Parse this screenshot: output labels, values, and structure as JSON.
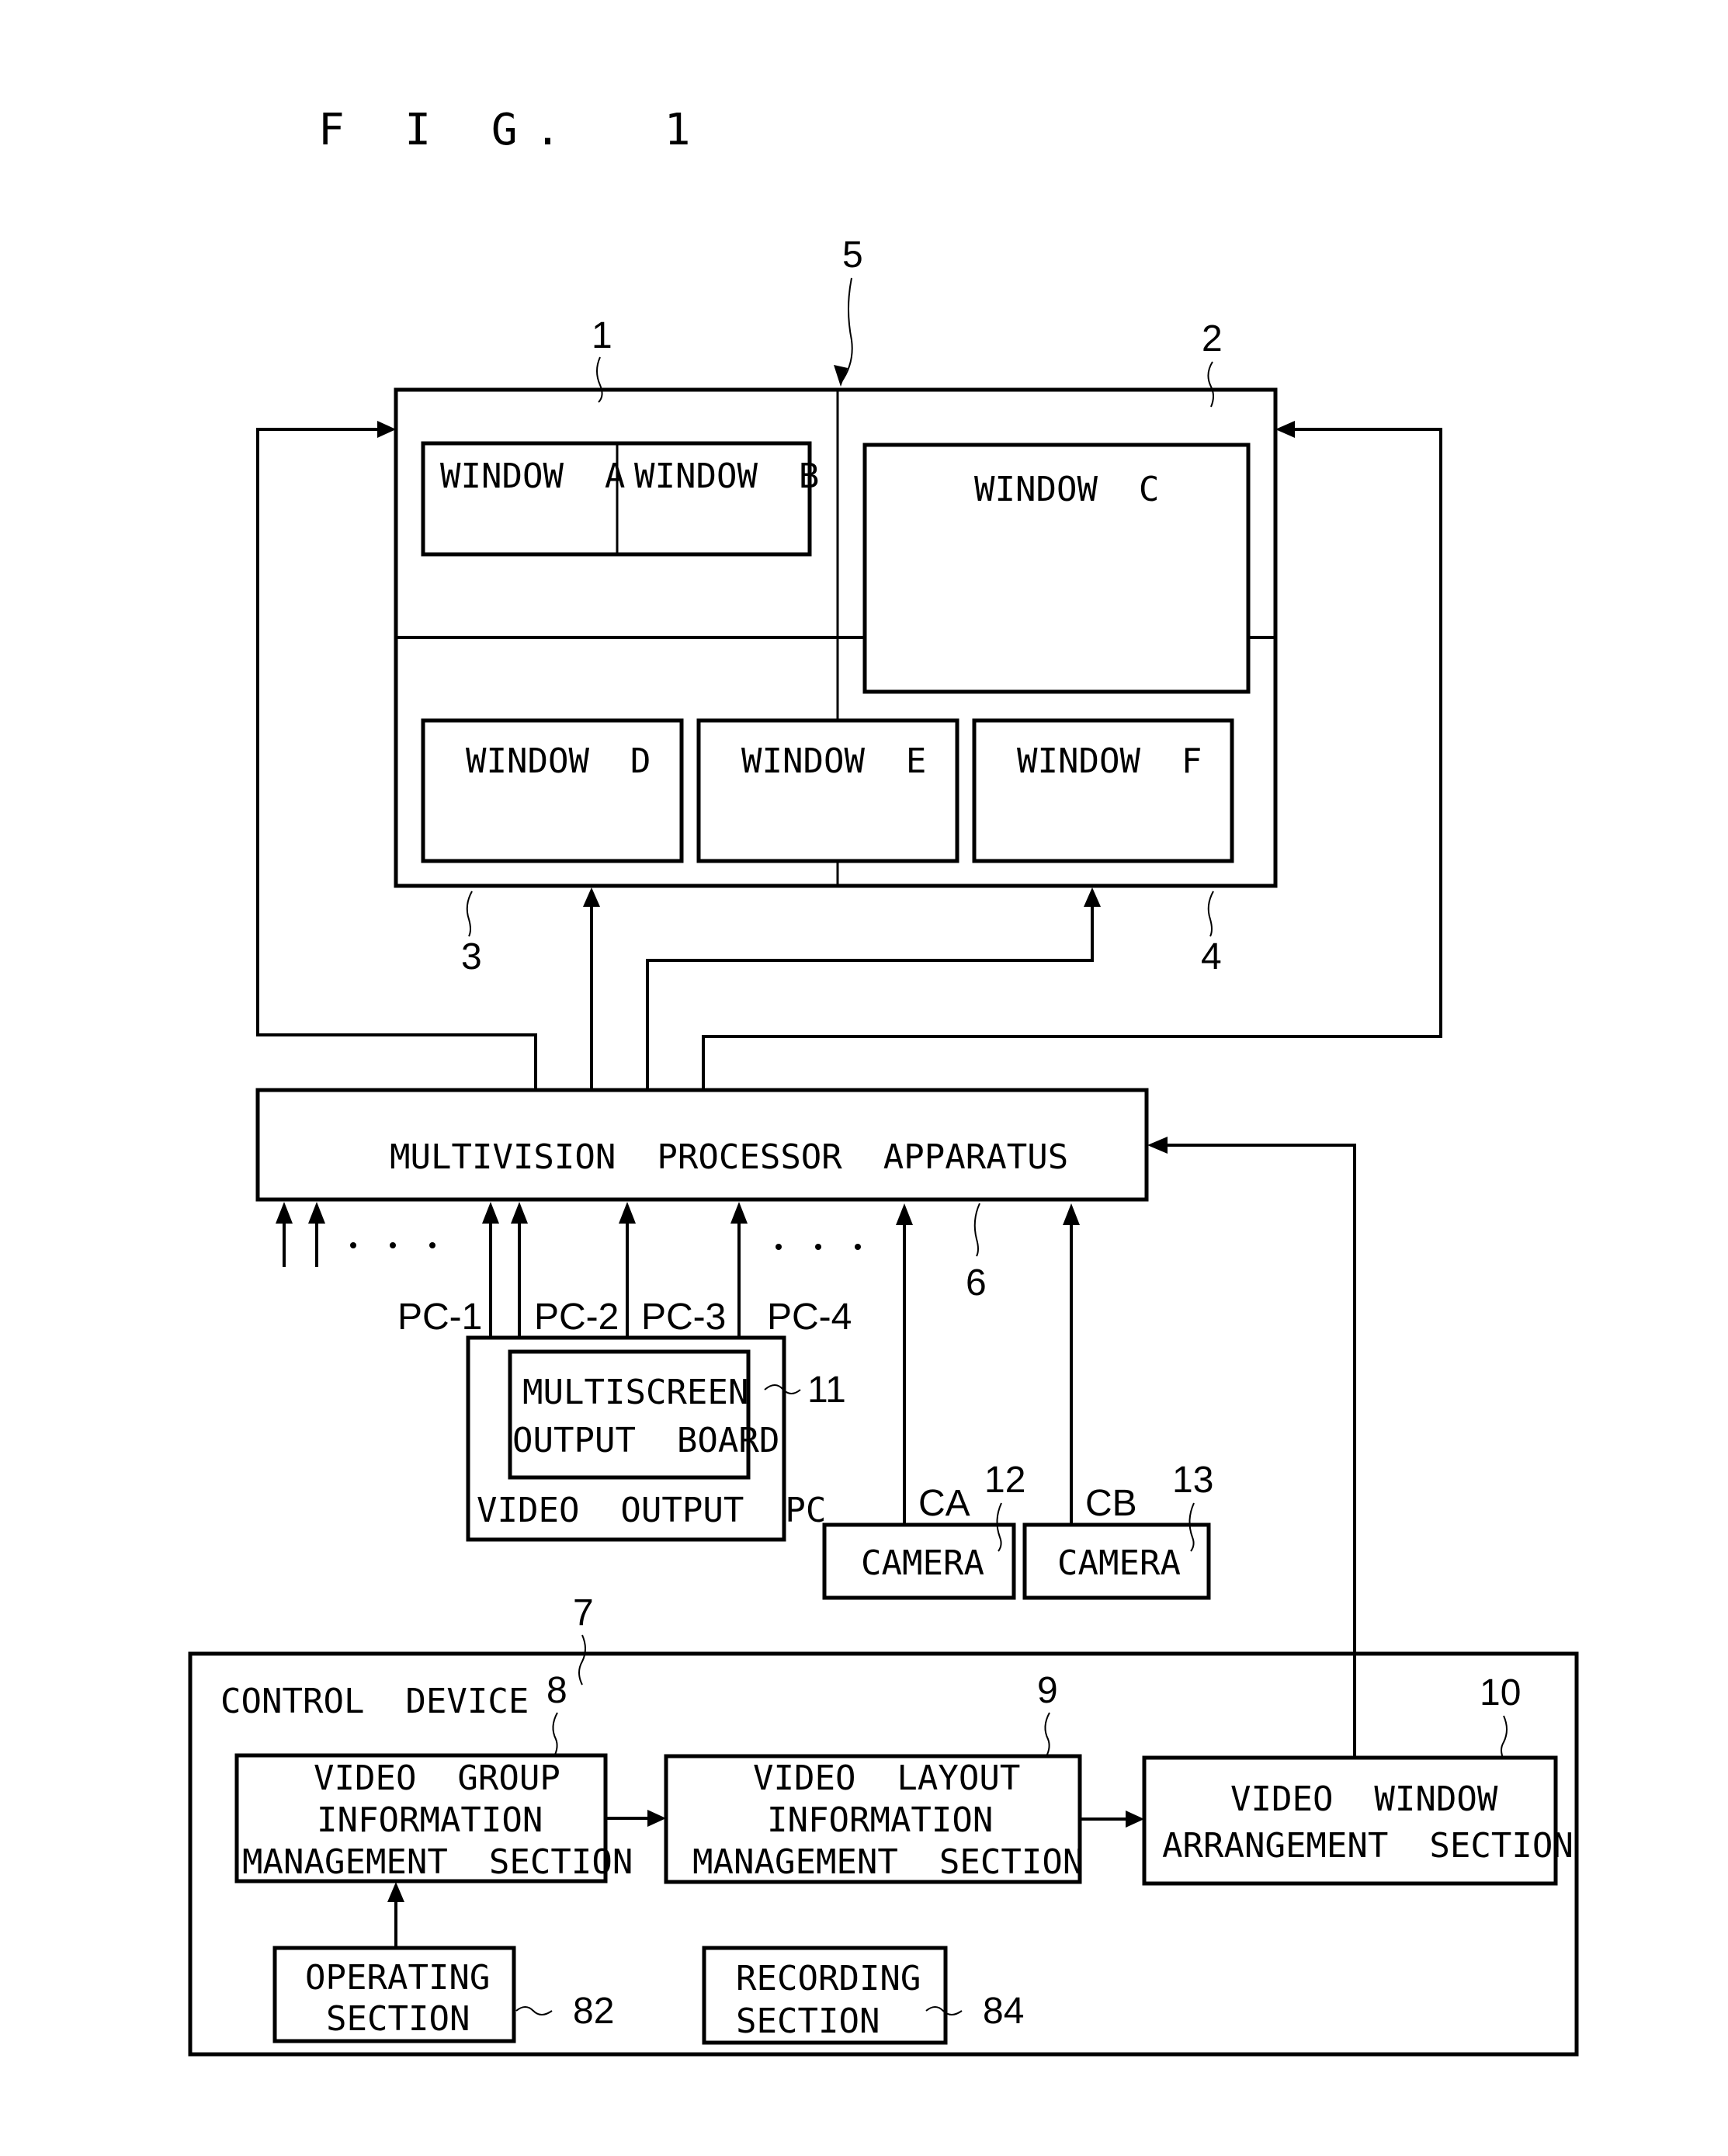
{
  "figure": {
    "title": "F I G.  1"
  },
  "display": {
    "ref_screen_1": "1",
    "ref_screen_2": "2",
    "ref_screen_3": "3",
    "ref_screen_4": "4",
    "ref_multiscreen": "5",
    "windows": [
      {
        "id": "A",
        "label": "WINDOW  A"
      },
      {
        "id": "B",
        "label": "WINDOW  B"
      },
      {
        "id": "C",
        "label": "WINDOW  C"
      },
      {
        "id": "D",
        "label": "WINDOW  D"
      },
      {
        "id": "E",
        "label": "WINDOW  E"
      },
      {
        "id": "F",
        "label": "WINDOW  F"
      }
    ]
  },
  "processor": {
    "label": "MULTIVISION  PROCESSOR  APPARATUS",
    "ref": "6",
    "ellipsis_left": "· · ·",
    "ellipsis_right": "· · ·"
  },
  "video_output_pc": {
    "label": "VIDEO  OUTPUT  PC",
    "board_line1": "MULTISCREEN",
    "board_line2": "OUTPUT  BOARD",
    "board_ref": "11",
    "channels": [
      "PC-1",
      "PC-2",
      "PC-3",
      "PC-4"
    ]
  },
  "cameras": [
    {
      "label": "CAMERA",
      "signal": "CA",
      "ref": "12"
    },
    {
      "label": "CAMERA",
      "signal": "CB",
      "ref": "13"
    }
  ],
  "control_device": {
    "label": "CONTROL  DEVICE",
    "ref": "7",
    "sections": {
      "video_group": {
        "line1": "VIDEO  GROUP",
        "line2": "INFORMATION",
        "line3": "MANAGEMENT  SECTION",
        "ref": "8"
      },
      "video_layout": {
        "line1": "VIDEO  LAYOUT",
        "line2": "INFORMATION",
        "line3": "MANAGEMENT  SECTION",
        "ref": "9"
      },
      "video_window": {
        "line1": "VIDEO  WINDOW",
        "line2": "ARRANGEMENT  SECTION",
        "ref": "10"
      },
      "operating": {
        "line1": "OPERATING",
        "line2": "SECTION",
        "ref": "82"
      },
      "recording": {
        "line1": "RECORDING",
        "line2": "SECTION",
        "ref": "84"
      }
    }
  }
}
